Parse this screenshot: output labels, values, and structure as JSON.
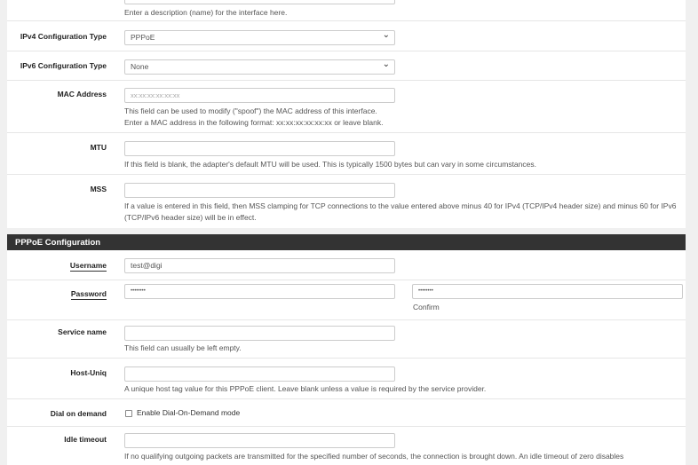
{
  "interface": {
    "description_help": "Enter a description (name) for the interface here.",
    "ipv4_label": "IPv4 Configuration Type",
    "ipv4_value": "PPPoE",
    "ipv6_label": "IPv6 Configuration Type",
    "ipv6_value": "None",
    "mac_label": "MAC Address",
    "mac_placeholder": "xx:xx:xx:xx:xx:xx",
    "mac_help1": "This field can be used to modify (\"spoof\") the MAC address of this interface.",
    "mac_help2": "Enter a MAC address in the following format: xx:xx:xx:xx:xx:xx or leave blank.",
    "mtu_label": "MTU",
    "mtu_help": "If this field is blank, the adapter's default MTU will be used. This is typically 1500 bytes but can vary in some circumstances.",
    "mss_label": "MSS",
    "mss_help": "If a value is entered in this field, then MSS clamping for TCP connections to the value entered above minus 40 for IPv4 (TCP/IPv4 header size) and minus 60 for IPv6 (TCP/IPv6 header size) will be in effect."
  },
  "pppoe": {
    "title": "PPPoE Configuration",
    "username_label": "Username",
    "username_value": "test@digi",
    "password_label": "Password",
    "password_value": "••••••••",
    "confirm_value": "••••••••",
    "confirm_label": "Confirm",
    "service_label": "Service name",
    "service_help": "This field can usually be left empty.",
    "hostuniq_label": "Host-Uniq",
    "hostuniq_help": "A unique host tag value for this PPPoE client. Leave blank unless a value is required by the service provider.",
    "dial_label": "Dial on demand",
    "dial_checkbox": "Enable Dial-On-Demand mode",
    "dial_checked": false,
    "idle_label": "Idle timeout",
    "idle_help": "If no qualifying outgoing packets are transmitted for the specified number of seconds, the connection is brought down. An idle timeout of zero disables"
  }
}
